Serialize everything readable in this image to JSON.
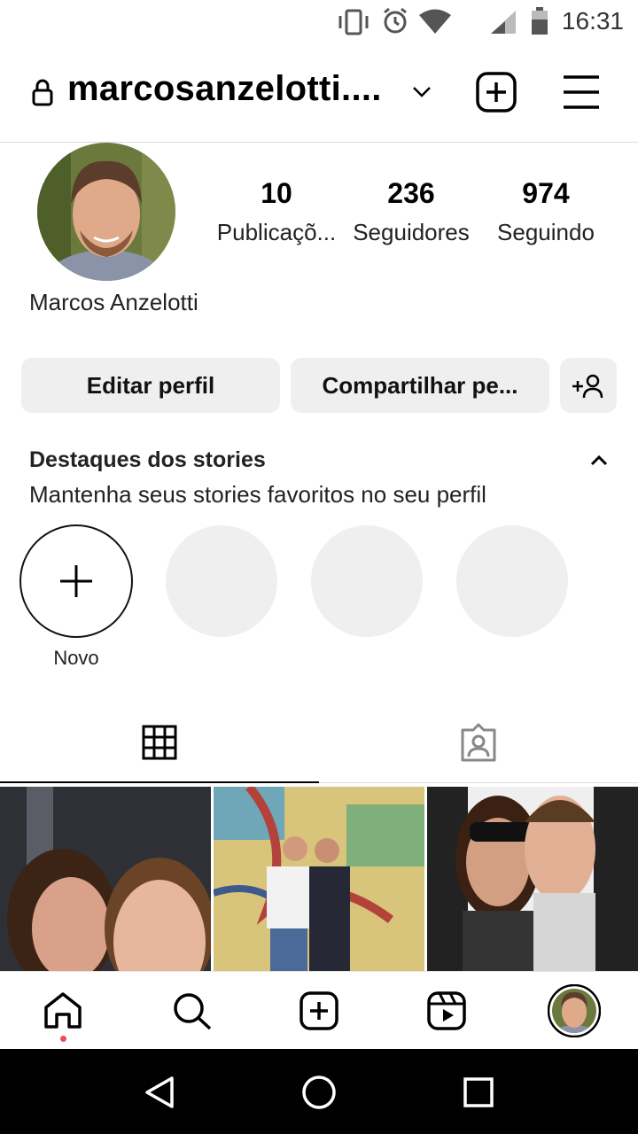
{
  "status_bar": {
    "time": "16:31",
    "icons": [
      "vibrate-icon",
      "alarm-icon",
      "wifi-icon",
      "signal-icon",
      "battery-icon"
    ]
  },
  "header": {
    "username": "marcosanzelotti....",
    "icons": [
      "lock-icon",
      "chevron-down-icon",
      "new-post-icon",
      "menu-icon"
    ]
  },
  "profile": {
    "full_name": "Marcos Anzelotti",
    "stats": [
      {
        "value": "10",
        "label": "Publicaçõ..."
      },
      {
        "value": "236",
        "label": "Seguidores"
      },
      {
        "value": "974",
        "label": "Seguindo"
      }
    ]
  },
  "buttons": {
    "edit": "Editar perfil",
    "share": "Compartilhar pe...",
    "discover_icon": "add-person-icon"
  },
  "highlights": {
    "title": "Destaques dos stories",
    "subtitle": "Mantenha seus stories favoritos no seu perfil",
    "new_label": "Novo"
  },
  "tabs": [
    "grid-icon",
    "tagged-icon"
  ],
  "bottom_nav": [
    "home-icon",
    "search-icon",
    "create-icon",
    "reels-icon",
    "profile-avatar"
  ],
  "colors": {
    "accent_dot": "#ed4956",
    "button_bg": "#efefef",
    "highlight_bg": "#efefef"
  }
}
